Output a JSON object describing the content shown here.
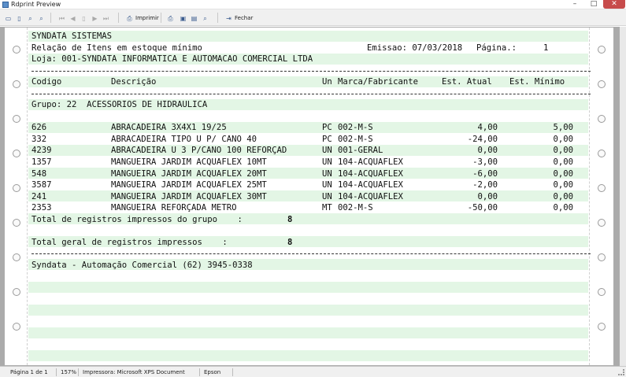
{
  "window": {
    "title": "Rdprint Preview",
    "min": "–",
    "max": "□",
    "close": "✕"
  },
  "toolbar": {
    "print_label": "Imprimir",
    "close_label": "Fechar"
  },
  "report": {
    "company": "SYNDATA SISTEMAS",
    "title": "Relação de Itens em estoque mínimo",
    "issue_label": "Emissao: 07/03/2018",
    "page_label": "Página.:",
    "page_number": "1",
    "store": "Loja: 001-SYNDATA INFORMATICA E AUTOMACAO COMERCIAL LTDA",
    "columns": {
      "code": "Codigo",
      "description": "Descrição",
      "unit": "Un",
      "brand": "Marca/Fabricante",
      "current_stock": "Est. Atual",
      "min_stock": "Est. Mínimo"
    },
    "group_line": "Grupo: 22  ACESSORIOS DE HIDRAULICA",
    "rows": [
      {
        "code": "626",
        "description": "ABRACADEIRA 3X4X1 19/25",
        "unit": "PC",
        "brand": "002-M-S",
        "current": "4,00",
        "min": "5,00"
      },
      {
        "code": "332",
        "description": "ABRACADEIRA TIPO U P/ CANO 40",
        "unit": "PC",
        "brand": "002-M-S",
        "current": "-24,00",
        "min": "0,00"
      },
      {
        "code": "4239",
        "description": "ABRACADEIRA U 3 P/CANO 100 REFORÇAD",
        "unit": "UN",
        "brand": "001-GERAL",
        "current": "0,00",
        "min": "0,00"
      },
      {
        "code": "1357",
        "description": "MANGUEIRA JARDIM ACQUAFLEX 10MT",
        "unit": "UN",
        "brand": "104-ACQUAFLEX",
        "current": "-3,00",
        "min": "0,00"
      },
      {
        "code": "548",
        "description": "MANGUEIRA JARDIM ACQUAFLEX 20MT",
        "unit": "UN",
        "brand": "104-ACQUAFLEX",
        "current": "-6,00",
        "min": "0,00"
      },
      {
        "code": "3587",
        "description": "MANGUEIRA JARDIM ACQUAFLEX 25MT",
        "unit": "UN",
        "brand": "104-ACQUAFLEX",
        "current": "-2,00",
        "min": "0,00"
      },
      {
        "code": "241",
        "description": "MANGUEIRA JARDIM ACQUAFLEX 30MT",
        "unit": "UN",
        "brand": "104-ACQUAFLEX",
        "current": "0,00",
        "min": "0,00"
      },
      {
        "code": "2353",
        "description": "MANGUEIRA REFORÇADA METRO",
        "unit": "MT",
        "brand": "002-M-S",
        "current": "-50,00",
        "min": "0,00"
      }
    ],
    "group_total_label": "Total de registros impressos do grupo    :",
    "group_total_value": "8",
    "grand_total_label": "Total geral de registros impressos    :",
    "grand_total_value": "8",
    "footer": "Syndata - Automação Comercial (62) 3945-0338"
  },
  "status": {
    "page": "Página 1 de 1",
    "zoom": "157%",
    "printer": "Impressora: Microsoft XPS Document Writer",
    "mode": "Epson"
  },
  "colors": {
    "band": "#e3f6e5",
    "close_button": "#c74b4b",
    "background": "#ababab"
  }
}
